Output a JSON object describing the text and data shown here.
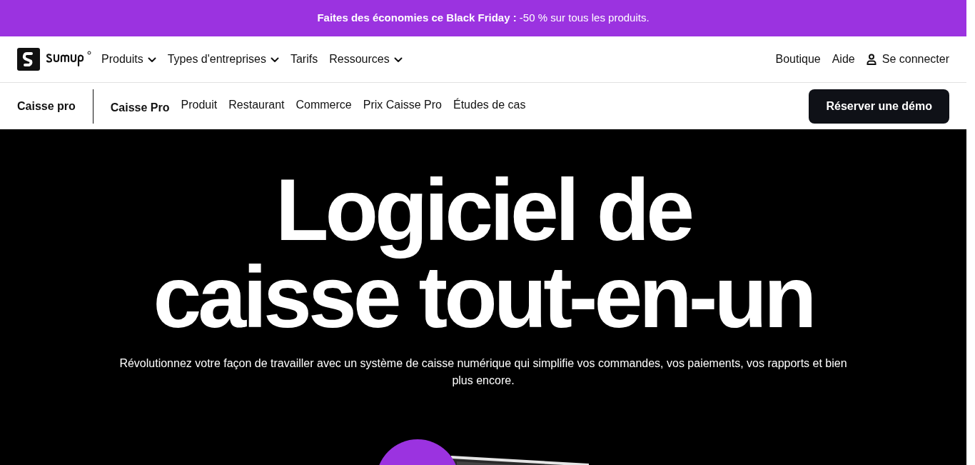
{
  "promo_banner": {
    "text": "**Faites des économies ce Black Friday :** -50 % sur tous les produits."
  },
  "main_nav": {
    "items": [
      {
        "label": "Produits",
        "dropdown": true
      },
      {
        "label": "Types d'entreprises",
        "dropdown": true
      },
      {
        "label": "Tarifs",
        "dropdown": false
      },
      {
        "label": "Ressources",
        "dropdown": true
      }
    ],
    "right_items": [
      {
        "label": "Boutique",
        "kind": "link"
      },
      {
        "label": "Aide",
        "kind": "link"
      },
      {
        "label": "Se connecter",
        "kind": "account"
      }
    ]
  },
  "sub_nav": {
    "section": "Caisse pro",
    "items": [
      {
        "label": "Caisse Pro",
        "selected": true
      },
      {
        "label": "Produit",
        "selected": false
      },
      {
        "label": "Restaurant",
        "selected": false
      },
      {
        "label": "Commerce",
        "selected": false
      },
      {
        "label": "Prix Caisse Pro",
        "selected": false
      },
      {
        "label": "Études de cas",
        "selected": false
      }
    ],
    "cta": "Réserver une démo"
  },
  "hero": {
    "title_lines": [
      "Logiciel de",
      "caisse tout-en-un"
    ],
    "subtitle": "Révolutionnez votre façon de travailler avec un système de caisse numérique qui simplifie vos commandes, vos paiements, vos rapports et bien plus encore.",
    "media": {
      "kind": "picture"
    }
  }
}
